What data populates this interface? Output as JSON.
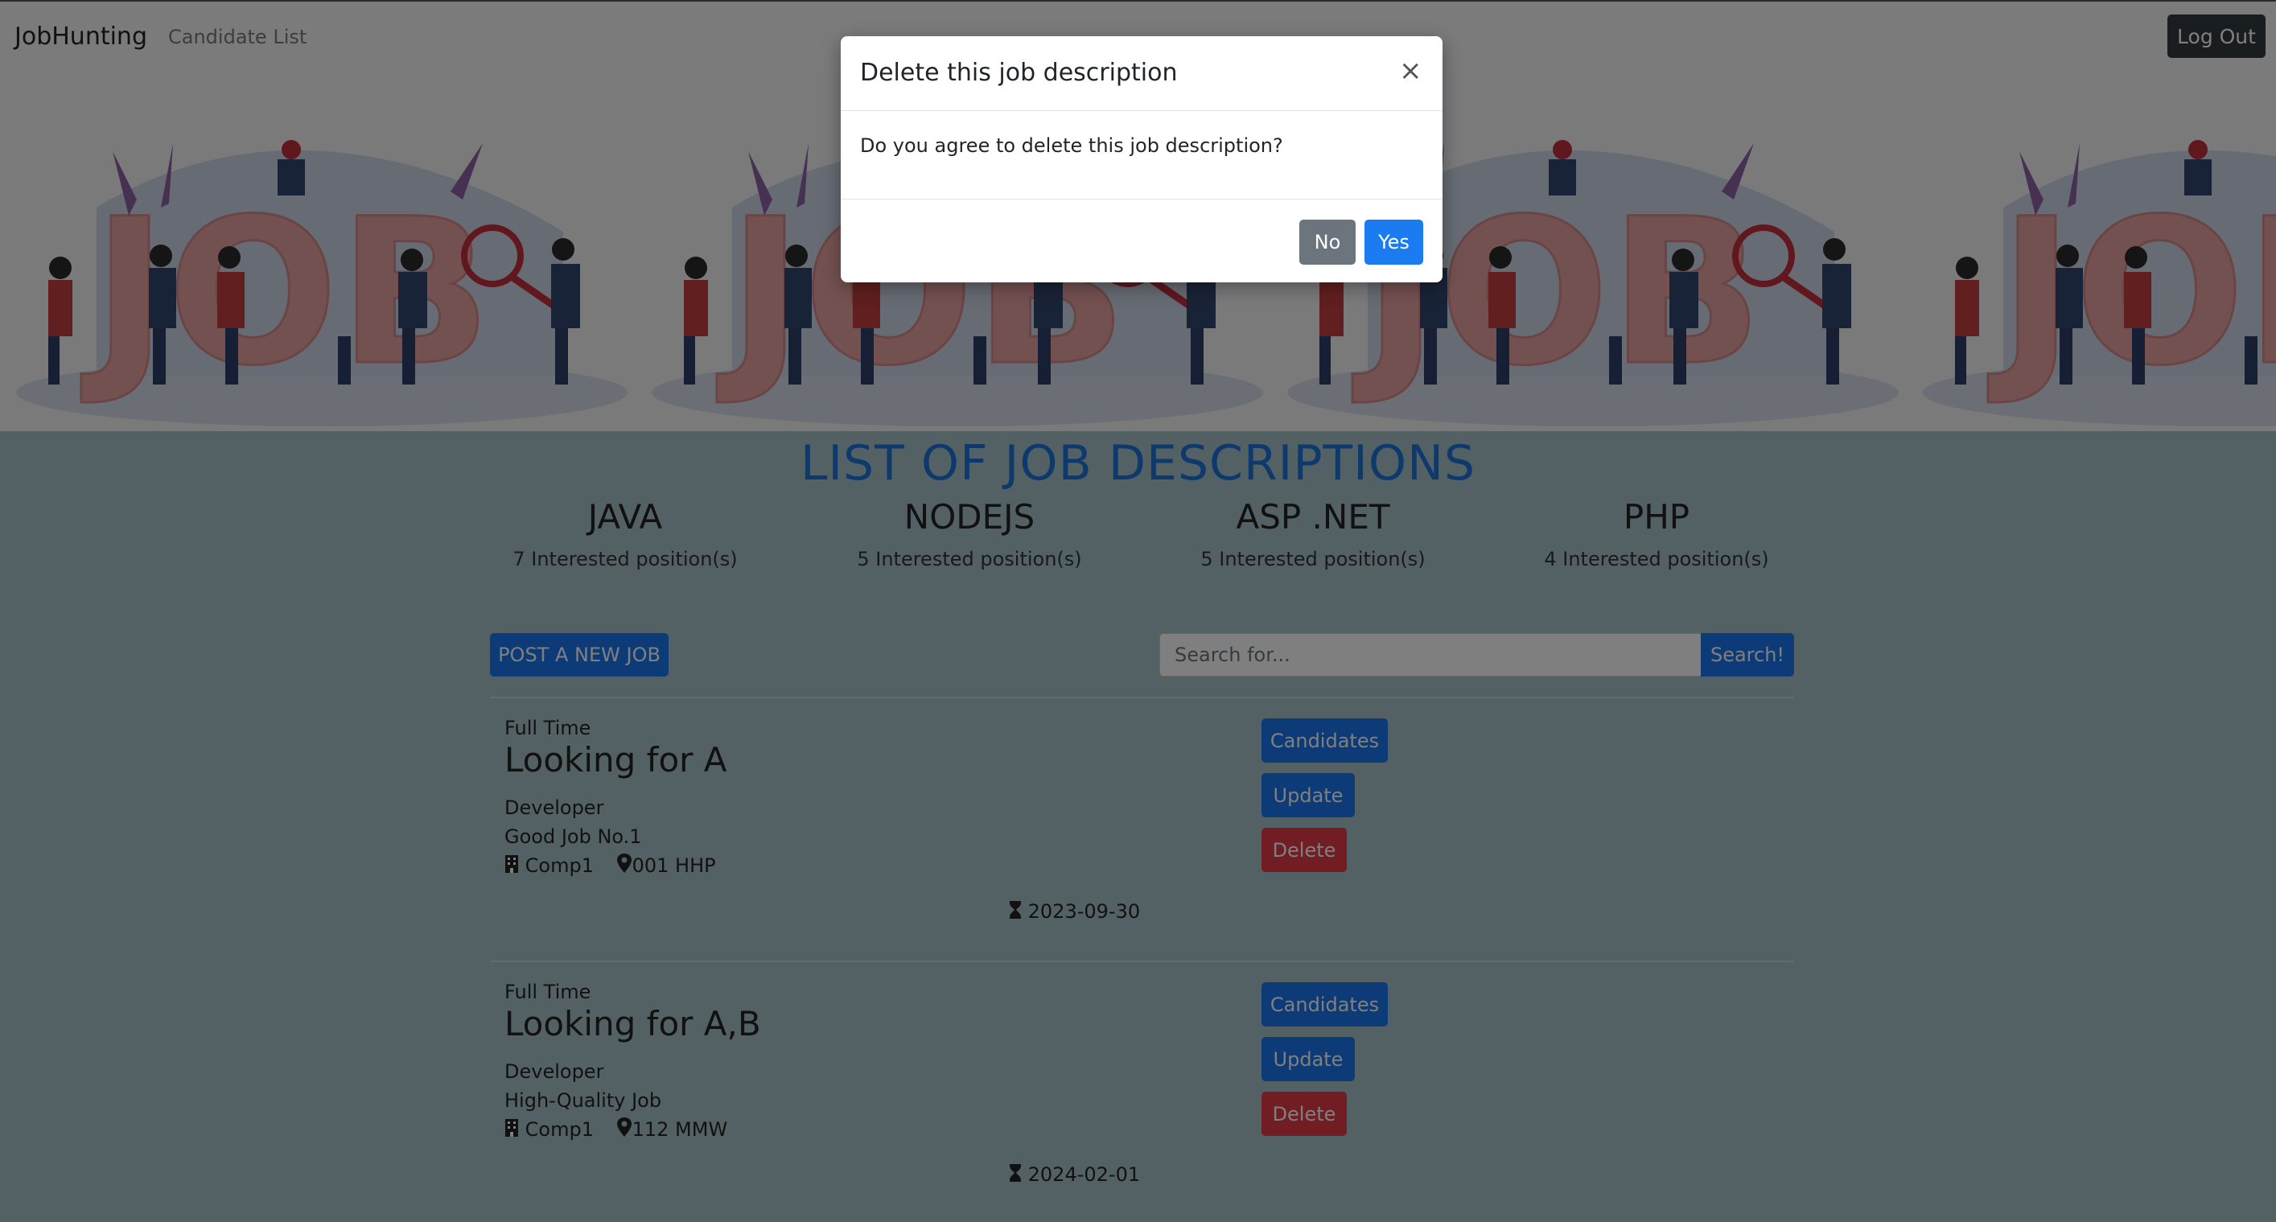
{
  "navbar": {
    "brand": "JobHunting",
    "link_candidates": "Candidate List",
    "logout_label": "Log Out"
  },
  "banner": {
    "illustration": "job-hunting-illustration",
    "repeat_text": "JOB"
  },
  "page": {
    "title": "LIST OF JOB DESCRIPTIONS"
  },
  "stats": [
    {
      "name": "JAVA",
      "count": "7 Interested position(s)"
    },
    {
      "name": "NODEJS",
      "count": "5 Interested position(s)"
    },
    {
      "name": "ASP .NET",
      "count": "5 Interested position(s)"
    },
    {
      "name": "PHP",
      "count": "4 Interested position(s)"
    }
  ],
  "toolbar": {
    "post_label": "POST A NEW JOB",
    "search_placeholder": "Search for...",
    "search_label": "Search!"
  },
  "jobs": [
    {
      "type": "Full Time",
      "title": "Looking for A",
      "position": "Developer",
      "description": "Good Job No.1",
      "company": "Comp1",
      "location": "001 HHP",
      "deadline": "2023-09-30"
    },
    {
      "type": "Full Time",
      "title": "Looking for A,B",
      "position": "Developer",
      "description": "High-Quality Job",
      "company": "Comp1",
      "location": "112 MMW",
      "deadline": "2024-02-01"
    }
  ],
  "job_actions": {
    "candidates": "Candidates",
    "update": "Update",
    "delete": "Delete"
  },
  "modal": {
    "title": "Delete this job description",
    "close": "×",
    "body": "Do you agree to delete this job description?",
    "no_label": "No",
    "yes_label": "Yes"
  },
  "icons": {
    "company": "building-icon",
    "location": "map-pin-icon",
    "deadline": "hourglass-icon"
  },
  "colors": {
    "primary": "#1b76ee",
    "danger": "#e23a47",
    "secondary": "#6c757d",
    "title_blue": "#1a73d9",
    "dark": "#343a40"
  }
}
